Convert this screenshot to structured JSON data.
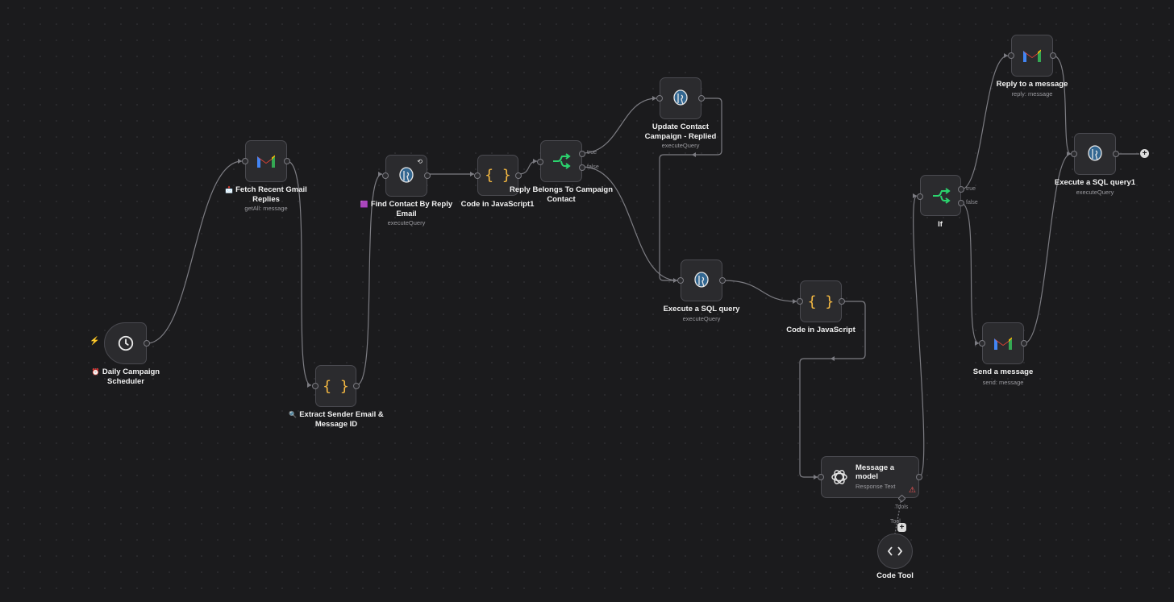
{
  "nodes": {
    "scheduler": {
      "title": "Daily Campaign Scheduler",
      "subtitle": "",
      "icon": "clock-icon",
      "badge": "⏰"
    },
    "fetch_gmail": {
      "title": "Fetch Recent Gmail Replies",
      "subtitle": "getAll: message",
      "icon": "gmail-icon",
      "badge": "📩"
    },
    "extract_sender": {
      "title": "Extract Sender Email & Message ID",
      "subtitle": "",
      "icon": "code-braces-icon",
      "badge": "🔍"
    },
    "find_contact": {
      "title": "Find Contact By Reply Email",
      "subtitle": "executeQuery",
      "icon": "postgres-icon",
      "badge": "🟪"
    },
    "code_js1": {
      "title": "Code in JavaScript1",
      "subtitle": "",
      "icon": "code-braces-icon"
    },
    "reply_belongs": {
      "title": "Reply Belongs To Campaign Contact",
      "subtitle": "",
      "icon": "if-branch-icon",
      "out_true": "true",
      "out_false": "false"
    },
    "update_contact": {
      "title": "Update Contact Campaign - Replied",
      "subtitle": "executeQuery",
      "icon": "postgres-icon"
    },
    "exec_sql": {
      "title": "Execute a SQL query",
      "subtitle": "executeQuery",
      "icon": "postgres-icon"
    },
    "code_js": {
      "title": "Code in JavaScript",
      "subtitle": "",
      "icon": "code-braces-icon"
    },
    "message_model": {
      "title": "Message a model",
      "subtitle": "Response Text",
      "icon": "openai-icon",
      "port_label": "Tools",
      "tool_label": "Tool"
    },
    "code_tool": {
      "title": "Code Tool",
      "subtitle": "",
      "icon": "code-tool-icon"
    },
    "if_node": {
      "title": "If",
      "subtitle": "",
      "icon": "if-branch-icon",
      "out_true": "true",
      "out_false": "false"
    },
    "reply_message": {
      "title": "Reply to a message",
      "subtitle": "reply: message",
      "icon": "gmail-icon"
    },
    "send_message": {
      "title": "Send a message",
      "subtitle": "send: message",
      "icon": "gmail-icon"
    },
    "exec_sql1": {
      "title": "Execute a SQL query1",
      "subtitle": "executeQuery",
      "icon": "postgres-icon"
    }
  },
  "colors": {
    "background": "#1b1b1d",
    "node": "#2b2b2e",
    "edge": "#7c7c82",
    "if_green": "#2bd46e",
    "code_yellow": "#f5b942",
    "postgres_blue": "#336791",
    "warning": "#ff5a5a"
  }
}
